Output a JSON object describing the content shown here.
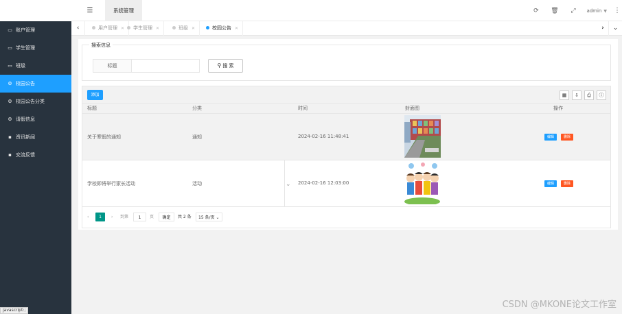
{
  "header": {
    "menu_toggle_icon": "list-icon",
    "active_menu": "系统管理",
    "user": "admin",
    "icons": [
      "refresh-icon",
      "trash-icon",
      "fullscreen-icon"
    ]
  },
  "sidebar": {
    "items": [
      {
        "label": "账户管理",
        "icon": "window-icon"
      },
      {
        "label": "学生管理",
        "icon": "window-icon"
      },
      {
        "label": "班级",
        "icon": "window-icon"
      },
      {
        "label": "校园公告",
        "icon": "gears-icon",
        "active": true
      },
      {
        "label": "校园公告分类",
        "icon": "gears-icon"
      },
      {
        "label": "请假信息",
        "icon": "gears-icon"
      },
      {
        "label": "资讯新闻",
        "icon": "file-icon"
      },
      {
        "label": "交流反馈",
        "icon": "file-icon"
      }
    ],
    "status": "javascript:;"
  },
  "tabs": [
    {
      "label": "用户管理",
      "active": false
    },
    {
      "label": "学生管理",
      "active": false
    },
    {
      "label": "班级",
      "active": false
    },
    {
      "label": "校园公告",
      "active": true
    }
  ],
  "search": {
    "legend": "搜索信息",
    "field_label": "标题",
    "value": "",
    "button": "搜 索"
  },
  "toolbar": {
    "add_label": "添加",
    "icons": [
      "columns-icon",
      "export-icon",
      "print-icon",
      "info-icon"
    ]
  },
  "table": {
    "columns": [
      "标题",
      "分类",
      "时间",
      "封面图",
      "操作"
    ],
    "rows": [
      {
        "title": "关于寒假的通知",
        "category": "通知",
        "time": "2024-02-16 11:48:41",
        "cover": "school-building-image"
      },
      {
        "title": "学校即将举行家长活动",
        "category": "活动",
        "time": "2024-02-16 12:03:00",
        "cover": "cartoon-children-image"
      }
    ],
    "edit_label": "编辑",
    "delete_label": "删除"
  },
  "pager": {
    "current": "1",
    "goto_label": "到第",
    "goto_value": "1",
    "page_unit": "页",
    "confirm": "确定",
    "total": "共 2 条",
    "page_size": "15 条/页"
  },
  "watermark": "CSDN @MKONE论文工作室",
  "colors": {
    "sidebar_bg": "#28333e",
    "accent": "#1e9fff",
    "danger": "#ff5722",
    "pager_active": "#009688"
  }
}
